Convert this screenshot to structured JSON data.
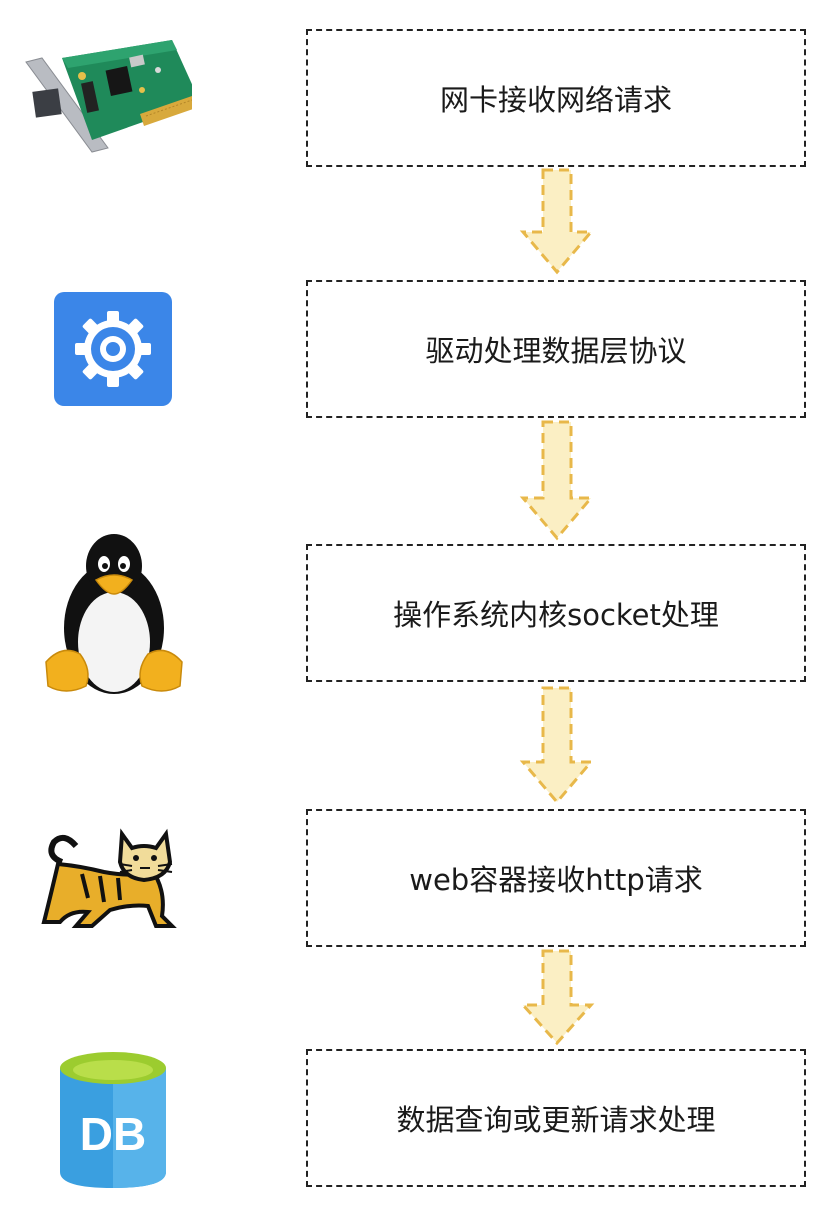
{
  "steps": [
    {
      "icon": "network-card-icon",
      "label": "网卡接收网络请求"
    },
    {
      "icon": "gear-settings-icon",
      "label": "驱动处理数据层协议"
    },
    {
      "icon": "linux-penguin-icon",
      "label": "操作系统内核socket处理"
    },
    {
      "icon": "tomcat-icon",
      "label": "web容器接收http请求"
    },
    {
      "icon": "database-icon",
      "label": "数据查询或更新请求处理"
    }
  ],
  "db_icon_text": "DB",
  "colors": {
    "arrow_fill": "#fbefc4",
    "arrow_stroke": "#e8b84a",
    "gear_bg": "#3b86e8",
    "db_body": "#3a9fe0",
    "db_top": "#9ccc2f"
  }
}
